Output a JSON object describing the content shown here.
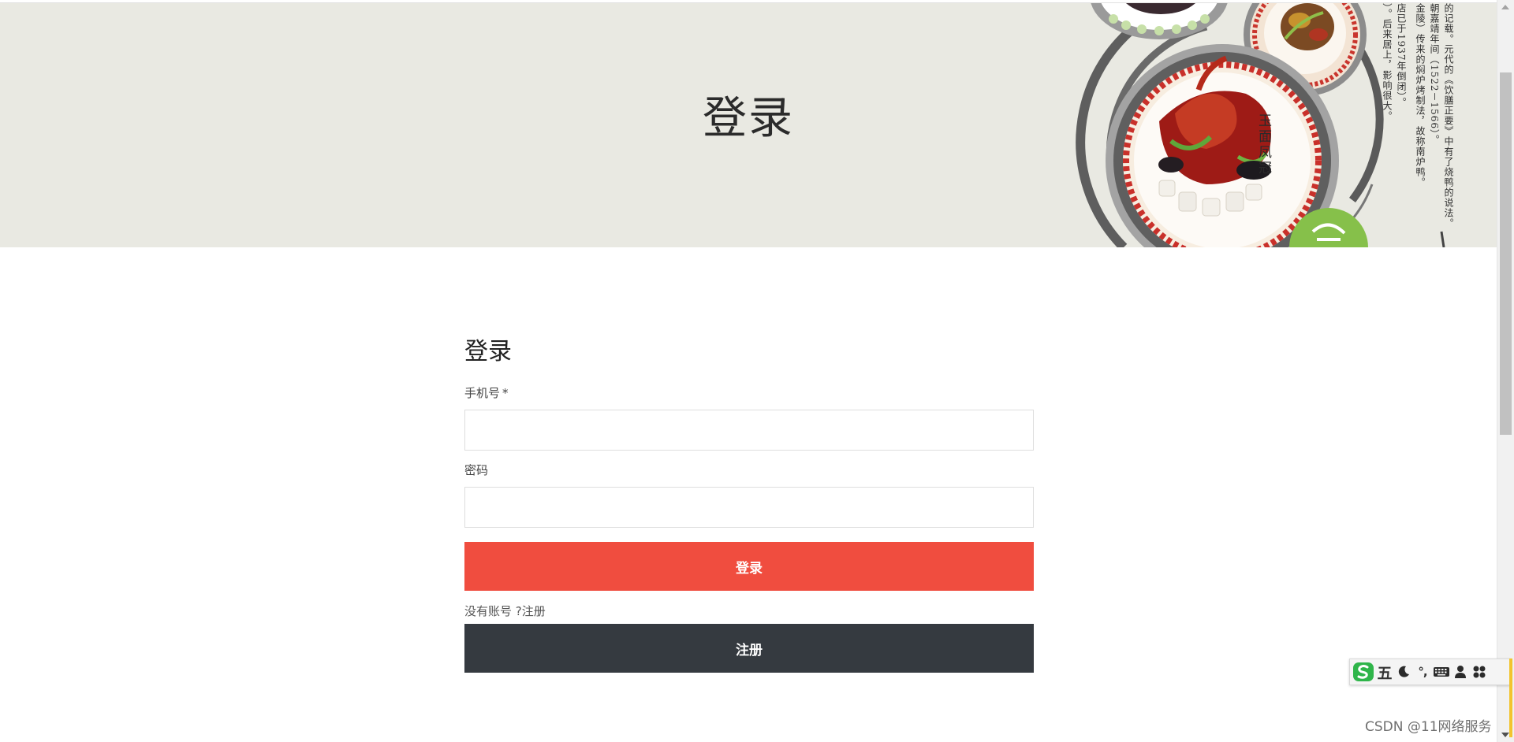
{
  "banner": {
    "title": "登录",
    "dish_name": "玉面凤冠",
    "vertical_text": [
      "的记载。元代的《饮膳正要》中有了烧鸭的说法。",
      "朝嘉靖年间（1522－1566）。",
      "金陵）传来的焖炉烤制法，故称南炉鸭。",
      "店已于1937年倒闭）。",
      "）。后来居上，影响很大。"
    ],
    "badge_text": "滋"
  },
  "form": {
    "heading": "登录",
    "phone_label": "手机号",
    "required_mark": "*",
    "phone_value": "",
    "password_label": "密码",
    "password_value": "",
    "login_button": "登录",
    "no_account_text": "没有账号 ?",
    "register_link": "注册",
    "register_button": "注册"
  },
  "ime_toolbar": {
    "logo": "sogou-icon",
    "mode": "五",
    "icons": [
      "moon-icon",
      "punctuation-icon",
      "keyboard-icon",
      "user-icon",
      "apps-icon"
    ],
    "punctuation": "°,"
  },
  "watermark": "CSDN @11网络服务"
}
